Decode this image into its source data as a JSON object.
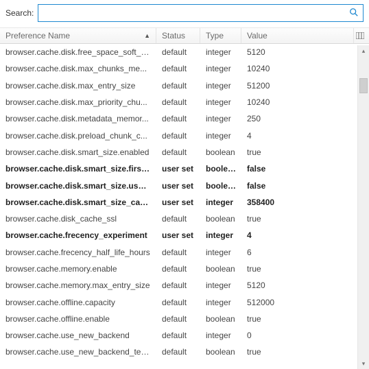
{
  "search": {
    "label": "Search:",
    "value": "",
    "placeholder": ""
  },
  "columns": {
    "pref": "Preference Name",
    "status": "Status",
    "type": "Type",
    "value": "Value",
    "sort_glyph": "▲"
  },
  "rows": [
    {
      "name": "browser.cache.disk.free_space_soft_li...",
      "status": "default",
      "type": "integer",
      "value": "5120",
      "bold": false
    },
    {
      "name": "browser.cache.disk.max_chunks_me...",
      "status": "default",
      "type": "integer",
      "value": "10240",
      "bold": false
    },
    {
      "name": "browser.cache.disk.max_entry_size",
      "status": "default",
      "type": "integer",
      "value": "51200",
      "bold": false
    },
    {
      "name": "browser.cache.disk.max_priority_chu...",
      "status": "default",
      "type": "integer",
      "value": "10240",
      "bold": false
    },
    {
      "name": "browser.cache.disk.metadata_memor...",
      "status": "default",
      "type": "integer",
      "value": "250",
      "bold": false
    },
    {
      "name": "browser.cache.disk.preload_chunk_c...",
      "status": "default",
      "type": "integer",
      "value": "4",
      "bold": false
    },
    {
      "name": "browser.cache.disk.smart_size.enabled",
      "status": "default",
      "type": "boolean",
      "value": "true",
      "bold": false
    },
    {
      "name": "browser.cache.disk.smart_size.first...",
      "status": "user set",
      "type": "boolean",
      "value": "false",
      "bold": true
    },
    {
      "name": "browser.cache.disk.smart_size.use_...",
      "status": "user set",
      "type": "boolean",
      "value": "false",
      "bold": true
    },
    {
      "name": "browser.cache.disk.smart_size_cac...",
      "status": "user set",
      "type": "integer",
      "value": "358400",
      "bold": true
    },
    {
      "name": "browser.cache.disk_cache_ssl",
      "status": "default",
      "type": "boolean",
      "value": "true",
      "bold": false
    },
    {
      "name": "browser.cache.frecency_experiment",
      "status": "user set",
      "type": "integer",
      "value": "4",
      "bold": true
    },
    {
      "name": "browser.cache.frecency_half_life_hours",
      "status": "default",
      "type": "integer",
      "value": "6",
      "bold": false
    },
    {
      "name": "browser.cache.memory.enable",
      "status": "default",
      "type": "boolean",
      "value": "true",
      "bold": false
    },
    {
      "name": "browser.cache.memory.max_entry_size",
      "status": "default",
      "type": "integer",
      "value": "5120",
      "bold": false
    },
    {
      "name": "browser.cache.offline.capacity",
      "status": "default",
      "type": "integer",
      "value": "512000",
      "bold": false
    },
    {
      "name": "browser.cache.offline.enable",
      "status": "default",
      "type": "boolean",
      "value": "true",
      "bold": false
    },
    {
      "name": "browser.cache.use_new_backend",
      "status": "default",
      "type": "integer",
      "value": "0",
      "bold": false
    },
    {
      "name": "browser.cache.use_new_backend_temp",
      "status": "default",
      "type": "boolean",
      "value": "true",
      "bold": false
    }
  ]
}
